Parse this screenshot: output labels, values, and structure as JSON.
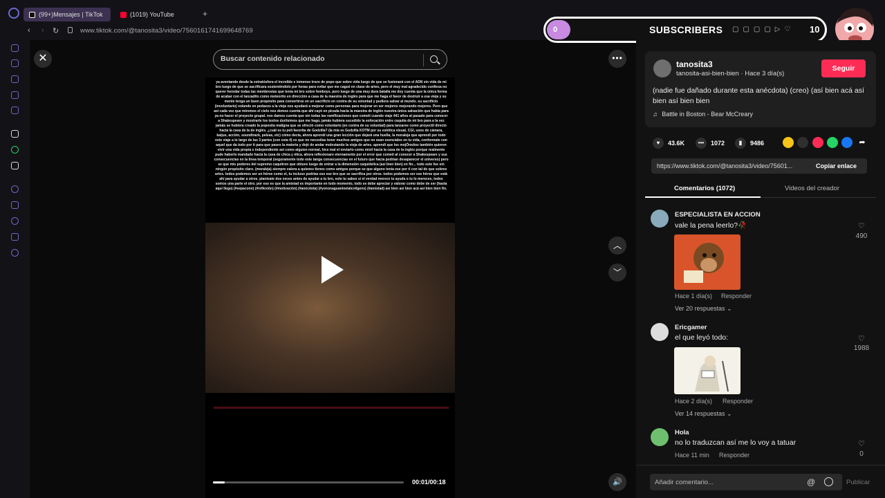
{
  "browser": {
    "tabs": [
      {
        "label": "(99+)Mensajes | TikTok",
        "icon": "tiktok-icon",
        "icon_color": "#ffffff"
      },
      {
        "label": "(1019) YouTube",
        "icon": "youtube-icon",
        "icon_color": "#ff0033"
      }
    ],
    "new_tab": "+",
    "url": "www.tiktok.com/@tanosita3/video/7560161741699648769"
  },
  "overlay": {
    "subscribers_count": "0",
    "subscribers_label": "SUBSCRIBERS",
    "subscribers_goal": "10"
  },
  "video": {
    "close": "✕",
    "search_placeholder": "Buscar contenido relacionado",
    "more": "•••",
    "overlay_text": "ya aventando desde la estratósfera el increíble e inmenso trozo de popo que sobre vida luego de que se fusionará con el ADN sin vida de mi bro luego de que se sacrificara sosteniéndolo por horas para evitar que me cagué en clase de artes, pero el muy mal agradecido confiesa no querer heredar todas las membresías que tenía mi bro sobre femboys. pero luego de una muy dura batalla me doy cuenta que la única forma de acabar con el lanzadito como meteorito en dirección a casa de la maestra de inglés para que me haga el favor de destruir a esa vieja y su mente tenga un buen propósito para convertirse en un sacrificio en contra de su voluntad y pudiera salvar al mundo. su sacrificio (involuntario) volando en pedazos a la vieja nos ayudará a mejorar como personas para mejorar en ser mejores mejorando mejores. Pero que así cada vez que miremos el cielo nos demos cuenta que ahí cayó en picada hacia la maestra de inglés nuestra única salvación que había para ya no hacer el proyecto grupal. nos damos cuenta que sin todas las ramificaciones que cometí cuando viaje 441 años al pasado para conocer a Shakespeare y mostrarle los textos duríisimos que me hago, jamás hubiera sucedido la sofocación entre caquita de mi bro para a la vez jamás se hubiera creado la popesita maligna que se ofreció como voluntario (en contra de su voluntad) para lanzarse como proyectil directo hacia la casa de la de inglés. ¿cuál es tu peli favorita de Godzilla? (la mía es Godzilla KOTM por su estética visual, CGI, usos de cámara, kaijus, acción, soundtrack, peleas, etc) cómo decía, ahora aprendí una gran lección que dejará una huella, la moraleja que aprendí por todo este viaje a lo largo de las 3 partes (con esta 4) es que no necesitas tener muchos amigos que no sean esenciales en tu vida, conformate con aquel que da todo por ti para que pases la materia y dejé de andar molestando la vieja de artes. aprendí que los mojÓnsitos también quieren vivir una vida propia e independiente así como alguien normal, hice mal el enviarlo como misil hacia la casa de la inglés porque realmente pude haberlo mandado hacia la casa de chica y ética. ahora reflexionare eternamente por el error que cometí al conocer a Shakespeare y sus consecuencias en la línea temporal (seguramente todo este tanga consecuencias en el futuro que hacia podrían desaparecer el universo) pero se que mis poderes del supremo caquitron que obtuve luego de entrar a la dimensión caquidelica (así bien bien) en fin... todo este fue sin ningún propósito claro. (moraleja) siempre valora a quienes tienes como amigos porque se que alguno tenía ese por ti con tal de que sobres artes. todos podemos ser un héroe como el, tu incluso podrías ese ese bro que se sacrifica por otros. todos podemos ser ese héroe que está ahí para ayudar a otros. planteate dos veces antes de ayudar a tu bro, solo tu sabes si el verdad merece tu ayuda o tu lo mereces, todos somos una parte el otro. por eso es que la amistad es importante en todo momento, todo se debe apreciar y valorar como debe de ser (hasta aquí llego) (#sepaconn) (#reflexión) (#motivación) (#anécdota) (#yononaguantoelalcoligens) (#amistad) así bien así bien acá así bien bien fin.",
    "time": "00:01/00:18",
    "progress": 0.06
  },
  "creator": {
    "name": "tanosita3",
    "subtitle": "tanosita-asi-bien-bien · Hace 3 día(s)",
    "follow_label": "Seguir",
    "follow_color": "#fe2c55",
    "description": "(nadie fue dañado durante esta anécdota) (creo) (así bien acá así bien así bien bien",
    "music_icon": "♫",
    "music": "Battle in Boston - Bear McCreary"
  },
  "stats": {
    "likes": "43.6K",
    "comments": "1072",
    "saves": "9486"
  },
  "share_icons": [
    {
      "icon": "coin-icon",
      "color": "#f5c518"
    },
    {
      "icon": "embed-icon",
      "color": "#2f2f2f"
    },
    {
      "icon": "repost-icon",
      "color": "#fe2c55"
    },
    {
      "icon": "whatsapp-icon",
      "color": "#25d366"
    },
    {
      "icon": "facebook-icon",
      "color": "#1877f2"
    },
    {
      "icon": "share-arrow-icon",
      "color": "#121212"
    }
  ],
  "link": {
    "url": "https://www.tiktok.com/@tanosita3/video/75601...",
    "copy_label": "Copiar enlace"
  },
  "tabs": {
    "comments": "Comentarios (1072)",
    "creator_videos": "Videos del creador"
  },
  "comments": [
    {
      "user": "ESPECIALISTA EN ACCION",
      "text": "vale la pena leerlo?🥀",
      "meta": "Hace 1 día(s)",
      "reply": "Responder",
      "more": "Ver 20 respuestas ⌄",
      "likes": "490"
    },
    {
      "user": "Ericgamer",
      "text": "el que leyó todo:",
      "meta": "Hace 2 día(s)",
      "reply": "Responder",
      "more": "Ver 14 respuestas ⌄",
      "likes": "1988"
    },
    {
      "user": "Hola",
      "text": "no lo traduzcan así me lo voy a tatuar",
      "meta": "Hace 11 min",
      "reply": "Responder",
      "likes": "0"
    }
  ],
  "comment_bar": {
    "placeholder": "Añadir comentario...",
    "at": "@",
    "publish": "Publicar"
  }
}
